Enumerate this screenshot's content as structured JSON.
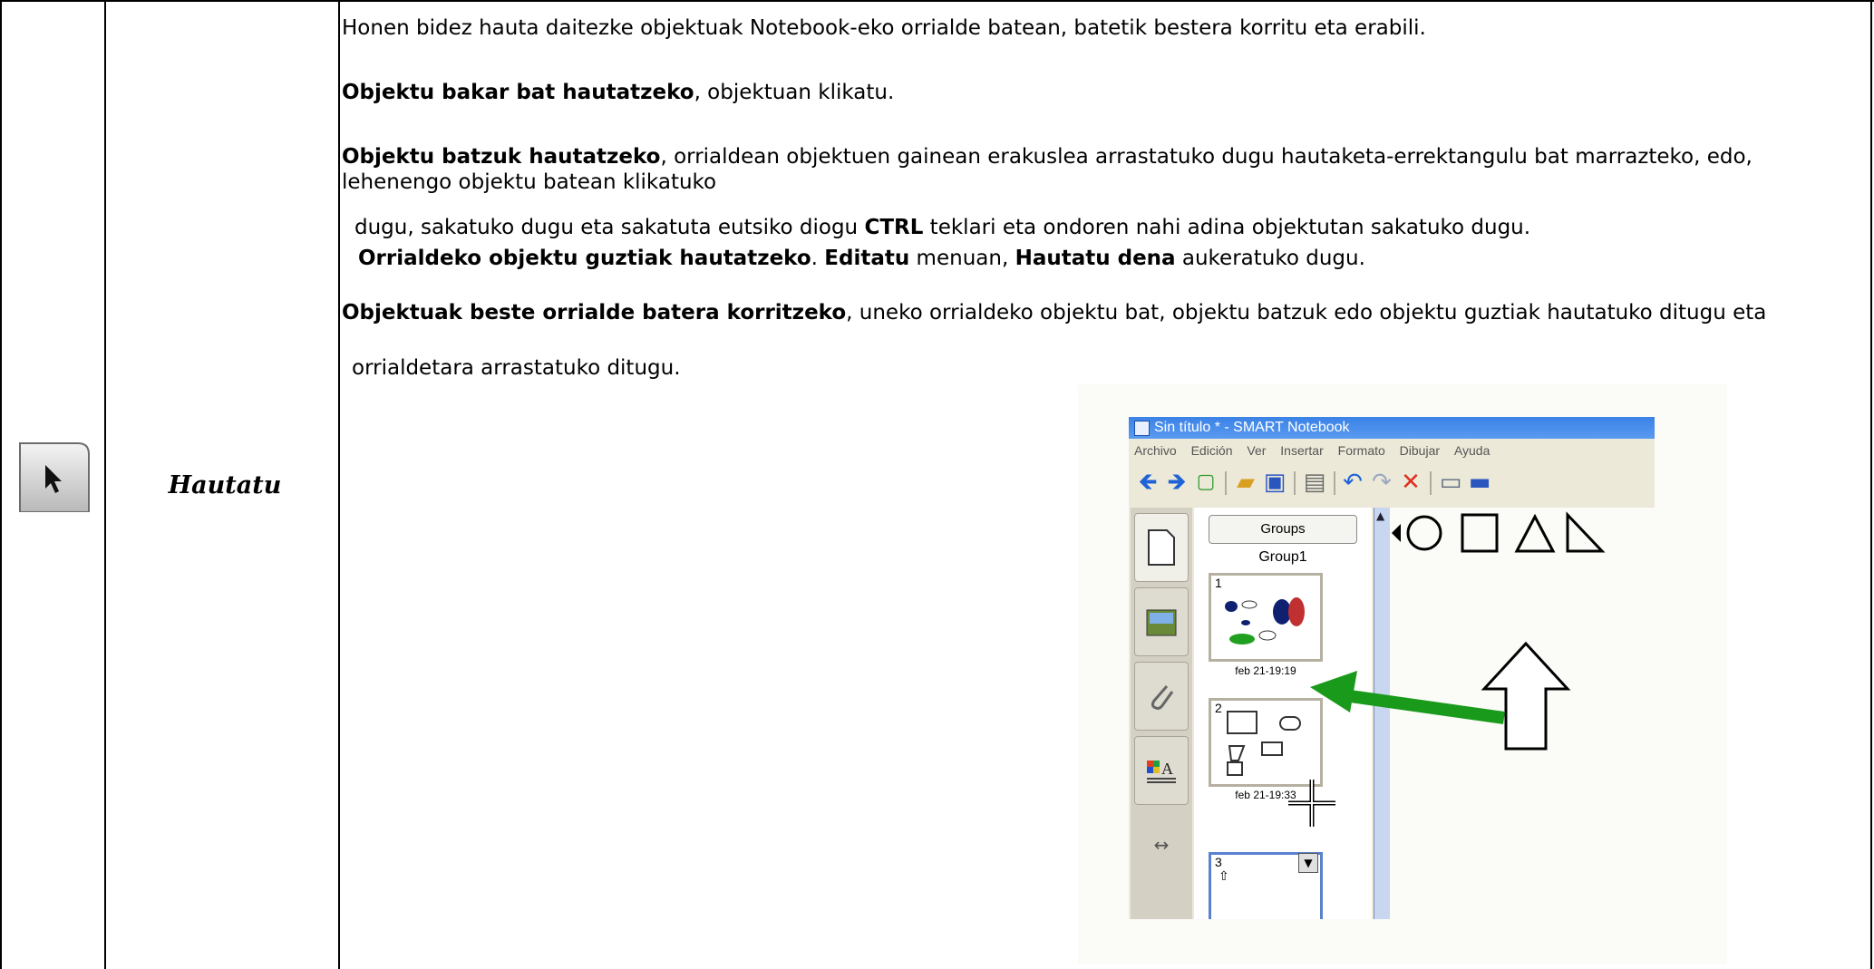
{
  "row": {
    "tool_name": "Hautatu",
    "paragraphs": {
      "p1": "Honen bidez hauta daitezke objektuak Notebook-eko orrialde batean, batetik bestera korritu eta erabili.",
      "p2_bold": "Objektu bakar bat hautatzeko",
      "p2_rest": ", objektuan klikatu.",
      "p3_bold": "Objektu batzuk hautatzeko",
      "p3_rest": ", orrialdean objektuen gainean erakuslea arrastatuko dugu hautaketa-errektangulu bat marrazteko, edo, lehenengo objektu batean klikatuko",
      "p4_a": "dugu, sakatuko dugu eta sakatuta eutsiko diogu ",
      "p4_bold": "CTRL",
      "p4_b": " teklari eta ondoren nahi adina objektutan sakatuko dugu.",
      "p5_bold1": "Orrialdeko objektu guztiak hautatzeko",
      "p5_a": ". ",
      "p5_bold2": "Editatu",
      "p5_b": " menuan, ",
      "p5_bold3": "Hautatu dena",
      "p5_c": " aukeratuko dugu.",
      "p6_bold": "Objektuak beste orrialde batera korritzeko",
      "p6_rest": ", uneko orrialdeko objektu bat, objektu batzuk edo objektu guztiak hautatuko ditugu eta",
      "p7": "orrialdetara arrastatuko ditugu."
    }
  },
  "screenshot": {
    "window_title": "Sin título * - SMART Notebook",
    "menu": [
      "Archivo",
      "Edición",
      "Ver",
      "Insertar",
      "Formato",
      "Dibujar",
      "Ayuda"
    ],
    "groups_button": "Groups",
    "group_label": "Group1",
    "pages": [
      {
        "number": "1",
        "date": "feb 21-19:19"
      },
      {
        "number": "2",
        "date": "feb 21-19:33"
      },
      {
        "number": "3"
      }
    ]
  },
  "colors": {
    "titlebar": "#3b82e6",
    "arrow_green": "#1a9a1a"
  }
}
